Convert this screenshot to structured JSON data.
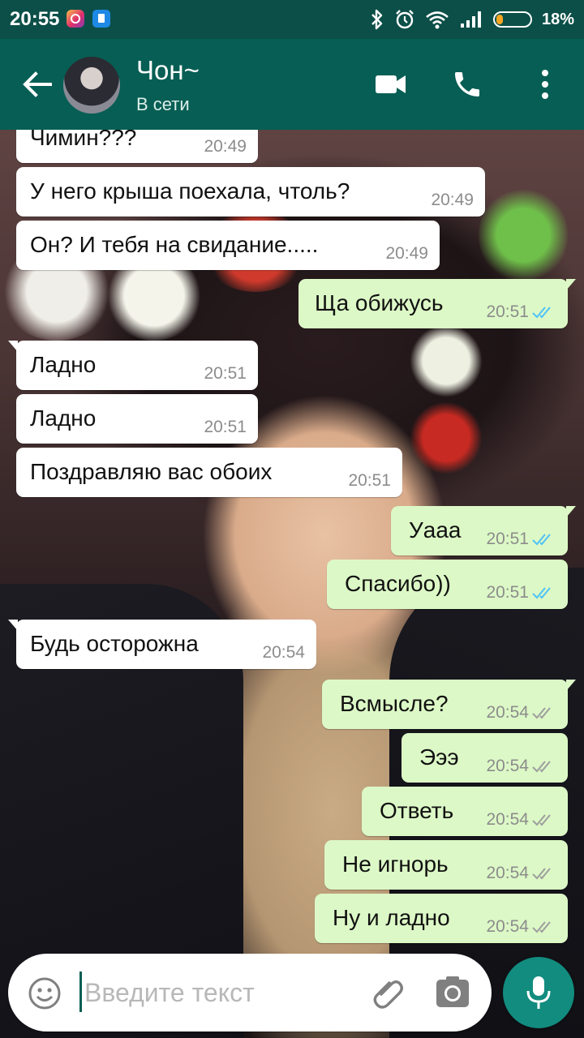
{
  "status_bar": {
    "time": "20:55",
    "battery_pct": "18%",
    "battery_level": 0.18,
    "icons": [
      "instagram-icon",
      "app-icon",
      "bluetooth-icon",
      "alarm-icon",
      "wifi-icon",
      "signal-icon",
      "battery-icon"
    ]
  },
  "header": {
    "contact_name": "Чон~",
    "contact_status": "В сети",
    "icons": [
      "back-arrow-icon",
      "video-call-icon",
      "phone-icon",
      "more-vert-icon"
    ]
  },
  "messages": [
    {
      "dir": "in",
      "text": "Чимин???",
      "time": "20:49"
    },
    {
      "dir": "in",
      "text": "У него крыша поехала, чтоль?",
      "time": "20:49"
    },
    {
      "dir": "in",
      "text": "Он? И тебя на свидание.....",
      "time": "20:49"
    },
    {
      "dir": "out",
      "text": "Ща обижусь",
      "time": "20:51",
      "status": "read"
    },
    {
      "dir": "in",
      "text": "Ладно",
      "time": "20:51"
    },
    {
      "dir": "in",
      "text": "Ладно",
      "time": "20:51"
    },
    {
      "dir": "in",
      "text": "Поздравляю вас обоих",
      "time": "20:51"
    },
    {
      "dir": "out",
      "text": "Уааа",
      "time": "20:51",
      "status": "read"
    },
    {
      "dir": "out",
      "text": "Спасибо))",
      "time": "20:51",
      "status": "read"
    },
    {
      "dir": "in",
      "text": "Будь осторожна",
      "time": "20:54"
    },
    {
      "dir": "out",
      "text": "Всмысле?",
      "time": "20:54",
      "status": "delivered"
    },
    {
      "dir": "out",
      "text": "Эээ",
      "time": "20:54",
      "status": "delivered"
    },
    {
      "dir": "out",
      "text": "Ответь",
      "time": "20:54",
      "status": "delivered"
    },
    {
      "dir": "out",
      "text": "Не игнорь",
      "time": "20:54",
      "status": "delivered"
    },
    {
      "dir": "out",
      "text": "Ну и ладно",
      "time": "20:54",
      "status": "delivered"
    }
  ],
  "input": {
    "placeholder": "Введите текст",
    "value": "",
    "icons": [
      "emoji-icon",
      "attach-icon",
      "camera-icon",
      "mic-icon"
    ]
  },
  "colors": {
    "header": "#075e54",
    "status_bar": "#0b4f48",
    "outgoing_bubble": "#dcf8c6",
    "incoming_bubble": "#ffffff",
    "read_ticks": "#4fc3f7",
    "delivered_ticks": "#9e9e9e",
    "mic_button": "#128c7e"
  }
}
